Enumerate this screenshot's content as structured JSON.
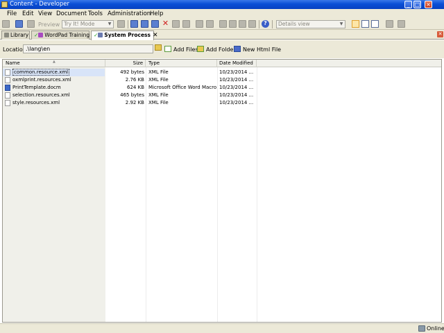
{
  "window": {
    "title": "Content - Developer"
  },
  "menubar": {
    "items": [
      {
        "label": "File"
      },
      {
        "label": "Edit"
      },
      {
        "label": "View"
      },
      {
        "label": "Document"
      },
      {
        "label": "Tools"
      },
      {
        "label": "Administration"
      },
      {
        "label": "Help"
      }
    ]
  },
  "toolbar": {
    "preview_label": "Preview",
    "mode_combo": "Try It! Mode",
    "view_combo": "Details view",
    "icons": [
      "new-icon",
      "save-icon",
      "print-icon",
      "cut-icon",
      "copy-icon",
      "paste-icon",
      "delete-icon",
      "undo-icon",
      "redo-icon",
      "find-icon",
      "help-icon",
      "details-view-icon",
      "list-view-icon"
    ]
  },
  "tabs": [
    {
      "label": "Library",
      "icon": "library-icon"
    },
    {
      "label": "WordPad Training",
      "icon": "check-icon"
    },
    {
      "label": "System Process",
      "icon": "check-icon",
      "active": true
    }
  ],
  "location": {
    "label": "Location:",
    "value": ".\\lang\\en"
  },
  "actions": [
    {
      "label": "Add Files"
    },
    {
      "label": "Add Folder"
    },
    {
      "label": "New Html File"
    }
  ],
  "columns": {
    "name": "Name",
    "size": "Size",
    "type": "Type",
    "date": "Date Modified"
  },
  "files": [
    {
      "name": "common.resource.xml",
      "size": "492 bytes",
      "type": "XML File",
      "date": "10/23/2014 ..."
    },
    {
      "name": "oxmlprint.resources.xml",
      "size": "2.76 KB",
      "type": "XML File",
      "date": "10/23/2014 ..."
    },
    {
      "name": "PrintTemplate.docm",
      "size": "624 KB",
      "type": "Microsoft Office Word Macro...",
      "date": "10/23/2014 ..."
    },
    {
      "name": "selection.resources.xml",
      "size": "465 bytes",
      "type": "XML File",
      "date": "10/23/2014 ..."
    },
    {
      "name": "style.resources.xml",
      "size": "2.92 KB",
      "type": "XML File",
      "date": "10/23/2014 ..."
    }
  ],
  "status": {
    "online": "Online"
  }
}
